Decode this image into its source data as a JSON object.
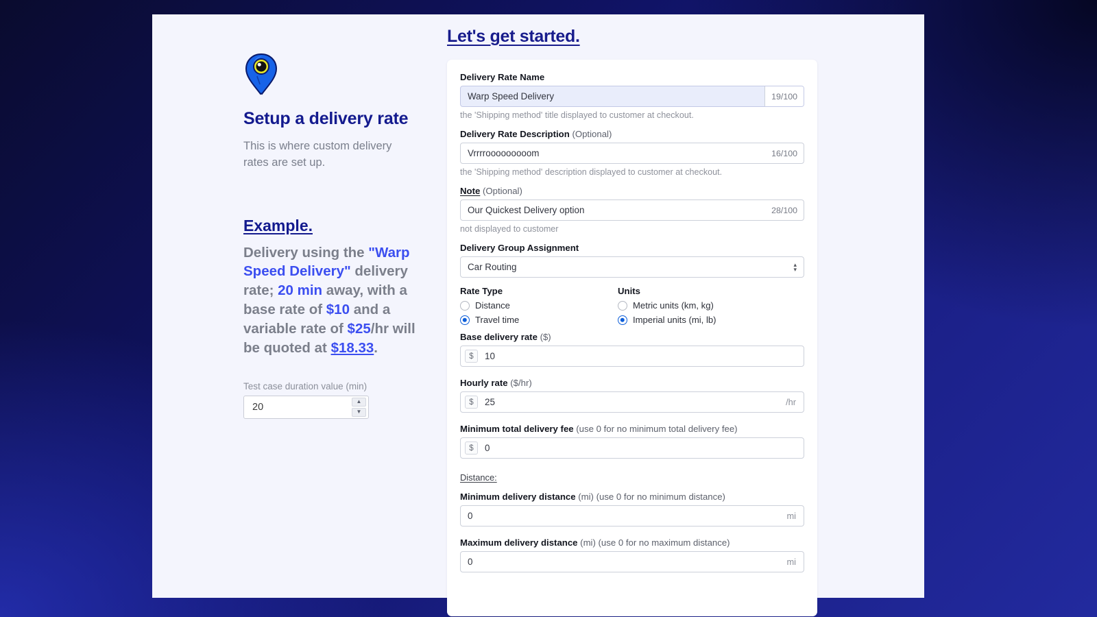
{
  "left": {
    "icon": "map-pin-icon",
    "title": "Setup a delivery rate",
    "subtitle": "This is where custom delivery rates are set up.",
    "example_heading": "Example.",
    "example": {
      "t1": "Delivery using the ",
      "rate_name": "\"Warp Speed Delivery\"",
      "t2": " delivery rate; ",
      "duration": "20 min",
      "t3": " away, with a base rate of ",
      "base": "$10",
      "t4": " and a variable rate of ",
      "hourly": "$25",
      "t5": "/hr will be quoted at ",
      "quote": "$18.33",
      "t6": "."
    },
    "test_case_label": "Test case duration value (min)",
    "test_case_value": "20",
    "spin_up": "▲",
    "spin_down": "▼"
  },
  "header": {
    "title": "Let's get started."
  },
  "form": {
    "name": {
      "label": "Delivery Rate Name",
      "value": "Warp Speed Delivery",
      "counter": "19/100",
      "help": "the 'Shipping method' title displayed to customer at checkout."
    },
    "description": {
      "label": "Delivery Rate Description",
      "optional": " (Optional)",
      "value": "Vrrrrooooooooom",
      "counter": "16/100",
      "help": "the 'Shipping method' description displayed to customer at checkout."
    },
    "note": {
      "label": "Note",
      "optional": " (Optional)",
      "value": "Our Quickest Delivery option",
      "counter": "28/100",
      "help": "not displayed to customer"
    },
    "group": {
      "label": "Delivery Group Assignment",
      "value": "Car Routing",
      "arrows_up": "▴",
      "arrows_down": "▾"
    },
    "rate_type": {
      "label": "Rate Type",
      "options": [
        {
          "label": "Distance",
          "selected": false
        },
        {
          "label": "Travel time",
          "selected": true
        }
      ]
    },
    "units": {
      "label": "Units",
      "options": [
        {
          "label": "Metric units (km, kg)",
          "selected": false
        },
        {
          "label": "Imperial units (mi, lb)",
          "selected": true
        }
      ]
    },
    "base_rate": {
      "label": "Base delivery rate",
      "unit": " ($)",
      "prefix": "$",
      "value": "10"
    },
    "hourly_rate": {
      "label": "Hourly rate",
      "unit": " ($/hr)",
      "prefix": "$",
      "value": "25",
      "suffix": "/hr"
    },
    "min_fee": {
      "label": "Minimum total delivery fee",
      "unit": " (use 0 for no minimum total delivery fee)",
      "prefix": "$",
      "value": "0"
    },
    "distance_section": "Distance:",
    "min_distance": {
      "label": "Minimum delivery distance",
      "unit": " (mi) (use 0 for no minimum distance)",
      "value": "0",
      "suffix": "mi"
    },
    "max_distance": {
      "label": "Maximum delivery distance",
      "unit": " (mi) (use 0 for no maximum distance)",
      "value": "0",
      "suffix": "mi"
    }
  },
  "colors": {
    "brand_navy": "#131a8e",
    "accent_blue": "#3b4ef0",
    "radio_blue": "#0d5ed9",
    "panel_bg": "#f4f5fd"
  }
}
